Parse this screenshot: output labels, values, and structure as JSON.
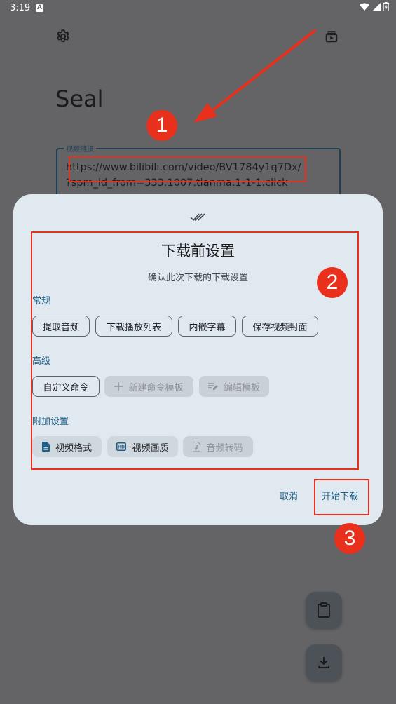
{
  "status_bar": {
    "time": "3:19",
    "notif_icon_letter": "A"
  },
  "app": {
    "title": "Seal"
  },
  "url_field": {
    "label": "视频链接",
    "line1": "https://www.bilibili.com/video/BV1784y1q7Dx/",
    "line2": "?spm_id_from=333.1007.tianma.1-1-1.click"
  },
  "sheet": {
    "title": "下载前设置",
    "subtitle": "确认此次下载的下载设置",
    "sections": {
      "general": {
        "label": "常规",
        "chips": [
          "提取音频",
          "下载播放列表",
          "内嵌字幕",
          "保存视频封面"
        ]
      },
      "advanced": {
        "label": "高级",
        "chips": [
          "自定义命令",
          "新建命令模板",
          "编辑模板"
        ]
      },
      "extra": {
        "label": "附加设置",
        "chips": [
          "视频格式",
          "视频画质",
          "音频转码"
        ]
      }
    },
    "cancel": "取消",
    "start": "开始下载"
  },
  "annotations": {
    "n1": "1",
    "n2": "2",
    "n3": "3"
  },
  "colors": {
    "accent": "#1f5f86",
    "annotation_red": "#e8301c",
    "scrim": "#646466",
    "sheet": "#e0e9f0"
  }
}
